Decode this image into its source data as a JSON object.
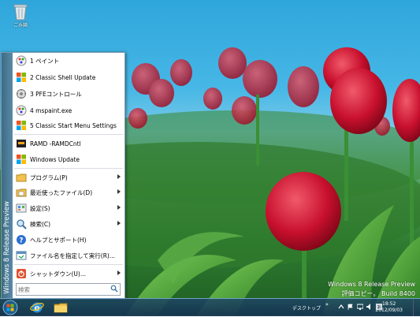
{
  "desktop": {
    "recycle_bin_label": "ごみ箱",
    "watermark_line1": "Windows 8 Release Preview",
    "watermark_line2": "評価コピー。 Build 8400"
  },
  "start_menu": {
    "banner": "Windows 8 Release Preview",
    "pinned": [
      {
        "label": "1 ペイント",
        "icon": "paint-icon"
      },
      {
        "label": "2 Classic Shell Update",
        "icon": "classic-shell-icon"
      },
      {
        "label": "3 PFEコントロール",
        "icon": "pfe-control-icon"
      },
      {
        "label": "4 mspaint.exe",
        "icon": "paint-icon"
      },
      {
        "label": "5 Classic Start Menu Settings",
        "icon": "classic-shell-icon"
      }
    ],
    "recent": [
      {
        "label": "RAMD -RAMDCntl",
        "icon": "ramdisk-icon"
      },
      {
        "label": "Windows Update",
        "icon": "windows-update-icon"
      }
    ],
    "main": [
      {
        "label": "プログラム(P)",
        "icon": "programs-icon",
        "submenu": true
      },
      {
        "label": "最近使ったファイル(D)",
        "icon": "recent-documents-icon",
        "submenu": true
      },
      {
        "label": "設定(S)",
        "icon": "settings-icon",
        "submenu": true
      },
      {
        "label": "検索(C)",
        "icon": "search-icon",
        "submenu": true
      },
      {
        "label": "ヘルプとサポート(H)",
        "icon": "help-icon",
        "submenu": false
      },
      {
        "label": "ファイル名を指定して実行(R)...",
        "icon": "run-icon",
        "submenu": false
      }
    ],
    "shutdown": {
      "label": "シャットダウン(U)...",
      "icon": "shutdown-icon",
      "submenu": true
    },
    "search": {
      "placeholder": "検索",
      "value": ""
    }
  },
  "taskbar": {
    "desktop_label": "デスクトップ",
    "time": "18:52",
    "date": "2012/09/03"
  }
}
